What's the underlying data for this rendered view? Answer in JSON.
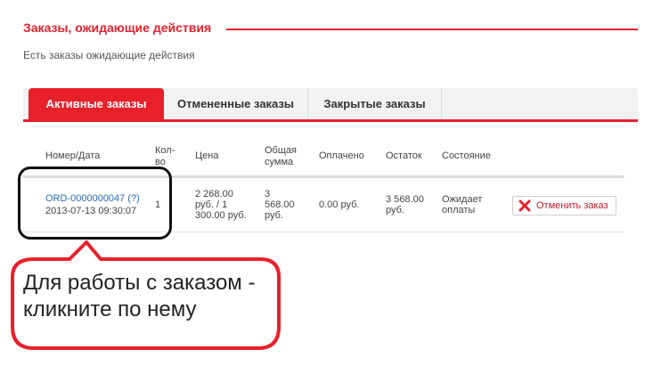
{
  "section": {
    "title": "Заказы, ожидающие действия",
    "subtitle": "Есть заказы ожидающие действия"
  },
  "tabs": [
    {
      "label": "Активные заказы",
      "active": true
    },
    {
      "label": "Отмененные заказы",
      "active": false
    },
    {
      "label": "Закрытые заказы",
      "active": false
    }
  ],
  "table": {
    "headers": {
      "number_date": "Номер/Дата",
      "qty_line1": "Кол-",
      "qty_line2": "во",
      "price": "Цена",
      "total_line1": "Общая",
      "total_line2": "сумма",
      "paid": "Оплачено",
      "remaining": "Остаток",
      "status": "Состояние"
    },
    "rows": [
      {
        "order_number": "ORD-0000000047",
        "help": "(?)",
        "date": "2013-07-13 09:30:07",
        "qty": "1",
        "price_line1": "2 268.00",
        "price_line2": "руб. / 1",
        "price_line3": "300.00 руб.",
        "total_line1": "3",
        "total_line2": "568.00",
        "total_line3": "руб.",
        "paid": "0.00 руб.",
        "remaining_line1": "3 568.00",
        "remaining_line2": "руб.",
        "status_line1": "Ожидает",
        "status_line2": "оплаты",
        "cancel_label": "Отменить заказ"
      }
    ]
  },
  "callout": {
    "line1": "Для работы с заказом -",
    "line2": "кликните по нему"
  },
  "colors": {
    "accent": "#e8202a",
    "link": "#2a6bb5",
    "annotation_box": "#111111",
    "callout_border": "#e8202a"
  },
  "icons": {
    "cancel": "close-x-icon"
  }
}
